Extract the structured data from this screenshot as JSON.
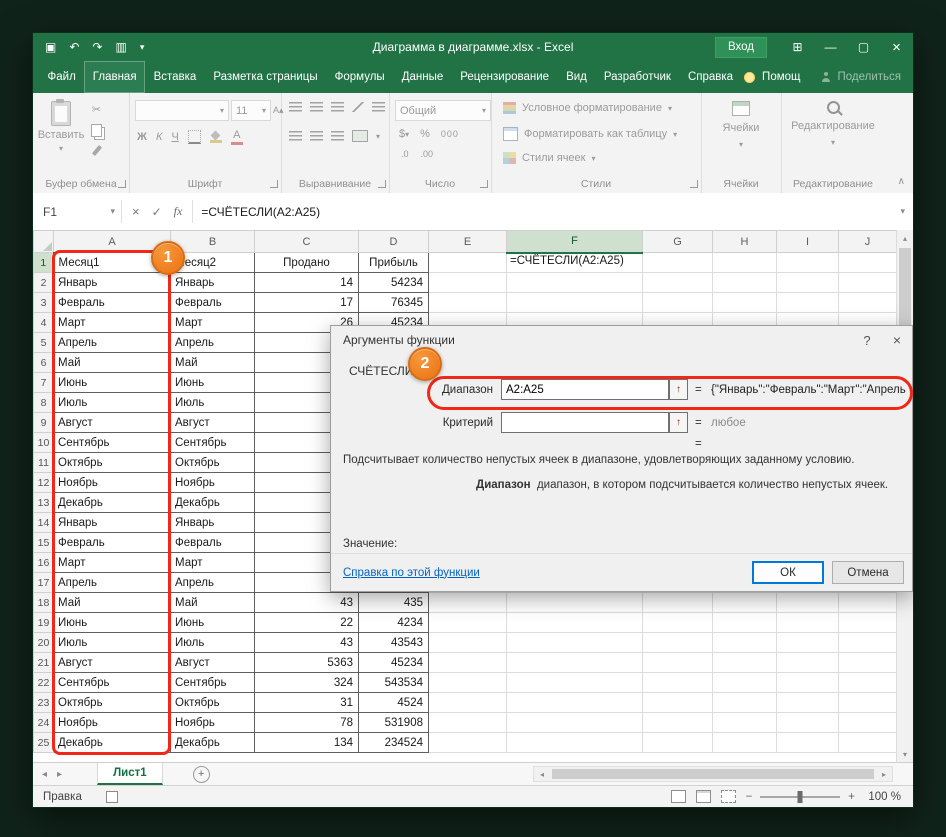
{
  "colors": {
    "excel_green": "#217346",
    "annotation_red": "#f12717",
    "annotation_orange": "#ee7d1e",
    "link_blue": "#0563c1"
  },
  "icons": {
    "save": "▣",
    "undo": "↶",
    "redo": "↷",
    "camera": "▥",
    "dropdown": "▾",
    "minimize": "—",
    "maximize": "▢",
    "close": "×",
    "ribbon_options": "⊞",
    "cancel": "×",
    "enter": "✓",
    "fx": "fx",
    "scissors": "✂",
    "chevron_up": "∧",
    "up_arrow": "↑",
    "left": "◂",
    "right": "▸",
    "up": "▴",
    "down": "▾",
    "plus": "+",
    "minus": "−",
    "help": "?",
    "currency": "$",
    "font_grow": "А▴",
    "font_shrink": "А▾",
    "font_color_letter": "А"
  },
  "titlebar": {
    "title": "Диаграмма в диаграмме.xlsx  -  Excel",
    "signin_label": "Вход"
  },
  "ribbon": {
    "tabs": [
      "Файл",
      "Главная",
      "Вставка",
      "Разметка страницы",
      "Формулы",
      "Данные",
      "Рецензирование",
      "Вид",
      "Разработчик",
      "Справка"
    ],
    "active_tab": "Главная",
    "help_label": "Помощ",
    "share_label": "Поделиться",
    "paste_label": "Вставить",
    "clipboard_group": "Буфер обмена",
    "font_group": "Шрифт",
    "font_size": "11",
    "bold": "Ж",
    "italic": "К",
    "underline": "Ч",
    "align_group": "Выравнивание",
    "number_group": "Число",
    "number_format": "Общий",
    "percent": "%",
    "thousands": "000",
    "dec_inc": ".0",
    "dec_dec": ".00",
    "styles_group": "Стили",
    "conditional_formatting": "Условное форматирование",
    "format_as_table": "Форматировать как таблицу",
    "cell_styles": "Стили ячеек",
    "cells_group": "Ячейки",
    "editing_group": "Редактирование"
  },
  "formula_bar": {
    "name_box": "F1",
    "formula": "=СЧЁТЕСЛИ(A2:A25)"
  },
  "grid": {
    "columns": [
      "A",
      "B",
      "C",
      "D",
      "E",
      "F",
      "G",
      "H",
      "I",
      "J"
    ],
    "selected_column": "F",
    "selected_row": "1",
    "rows": [
      {
        "n": "1",
        "a": "Месяц1",
        "b": "Месяц2",
        "c": "Продано",
        "d": "Прибыль",
        "f": "=СЧЁТЕСЛИ(A2:A25)"
      },
      {
        "n": "2",
        "a": "Январь",
        "b": "Январь",
        "c": "14",
        "d": "54234"
      },
      {
        "n": "3",
        "a": "Февраль",
        "b": "Февраль",
        "c": "17",
        "d": "76345"
      },
      {
        "n": "4",
        "a": "Март",
        "b": "Март",
        "c": "26",
        "d": "45234"
      },
      {
        "n": "5",
        "a": "Апрель",
        "b": "Апрель",
        "c": "",
        "d": ""
      },
      {
        "n": "6",
        "a": "Май",
        "b": "Май",
        "c": "",
        "d": ""
      },
      {
        "n": "7",
        "a": "Июнь",
        "b": "Июнь",
        "c": "",
        "d": ""
      },
      {
        "n": "8",
        "a": "Июль",
        "b": "Июль",
        "c": "",
        "d": ""
      },
      {
        "n": "9",
        "a": "Август",
        "b": "Август",
        "c": "",
        "d": ""
      },
      {
        "n": "10",
        "a": "Сентябрь",
        "b": "Сентябрь",
        "c": "",
        "d": ""
      },
      {
        "n": "11",
        "a": "Октябрь",
        "b": "Октябрь",
        "c": "",
        "d": ""
      },
      {
        "n": "12",
        "a": "Ноябрь",
        "b": "Ноябрь",
        "c": "",
        "d": ""
      },
      {
        "n": "13",
        "a": "Декабрь",
        "b": "Декабрь",
        "c": "",
        "d": ""
      },
      {
        "n": "14",
        "a": "Январь",
        "b": "Январь",
        "c": "",
        "d": ""
      },
      {
        "n": "15",
        "a": "Февраль",
        "b": "Февраль",
        "c": "",
        "d": ""
      },
      {
        "n": "16",
        "a": "Март",
        "b": "Март",
        "c": "",
        "d": ""
      },
      {
        "n": "17",
        "a": "Апрель",
        "b": "Апрель",
        "c": "",
        "d": ""
      },
      {
        "n": "18",
        "a": "Май",
        "b": "Май",
        "c": "43",
        "d": "435"
      },
      {
        "n": "19",
        "a": "Июнь",
        "b": "Июнь",
        "c": "22",
        "d": "4234"
      },
      {
        "n": "20",
        "a": "Июль",
        "b": "Июль",
        "c": "43",
        "d": "43543"
      },
      {
        "n": "21",
        "a": "Август",
        "b": "Август",
        "c": "5363",
        "d": "45234"
      },
      {
        "n": "22",
        "a": "Сентябрь",
        "b": "Сентябрь",
        "c": "324",
        "d": "543534"
      },
      {
        "n": "23",
        "a": "Октябрь",
        "b": "Октябрь",
        "c": "31",
        "d": "4524"
      },
      {
        "n": "24",
        "a": "Ноябрь",
        "b": "Ноябрь",
        "c": "78",
        "d": "531908"
      },
      {
        "n": "25",
        "a": "Декабрь",
        "b": "Декабрь",
        "c": "134",
        "d": "234524"
      }
    ]
  },
  "sheet_bar": {
    "sheet_name": "Лист1"
  },
  "status_bar": {
    "mode": "Правка",
    "zoom_level": "100 %"
  },
  "dialog": {
    "title": "Аргументы функции",
    "function_name": "СЧЁТЕСЛИ",
    "range_label": "Диапазон",
    "range_value": "A2:A25",
    "range_result": "{\"Январь\":\"Февраль\":\"Март\":\"Апрель",
    "criteria_label": "Критерий",
    "criteria_value": "",
    "criteria_result": "любое",
    "equals": "=",
    "description": "Подсчитывает количество непустых ячеек в диапазоне, удовлетворяющих заданному условию.",
    "param_name": "Диапазон",
    "param_description": "диапазон, в котором подсчитывается количество непустых ячеек.",
    "value_label": "Значение:",
    "help_link_label": "Справка по этой функции",
    "ok_label": "ОК",
    "cancel_label": "Отмена"
  },
  "annotations": {
    "step1": "1",
    "step2": "2"
  }
}
